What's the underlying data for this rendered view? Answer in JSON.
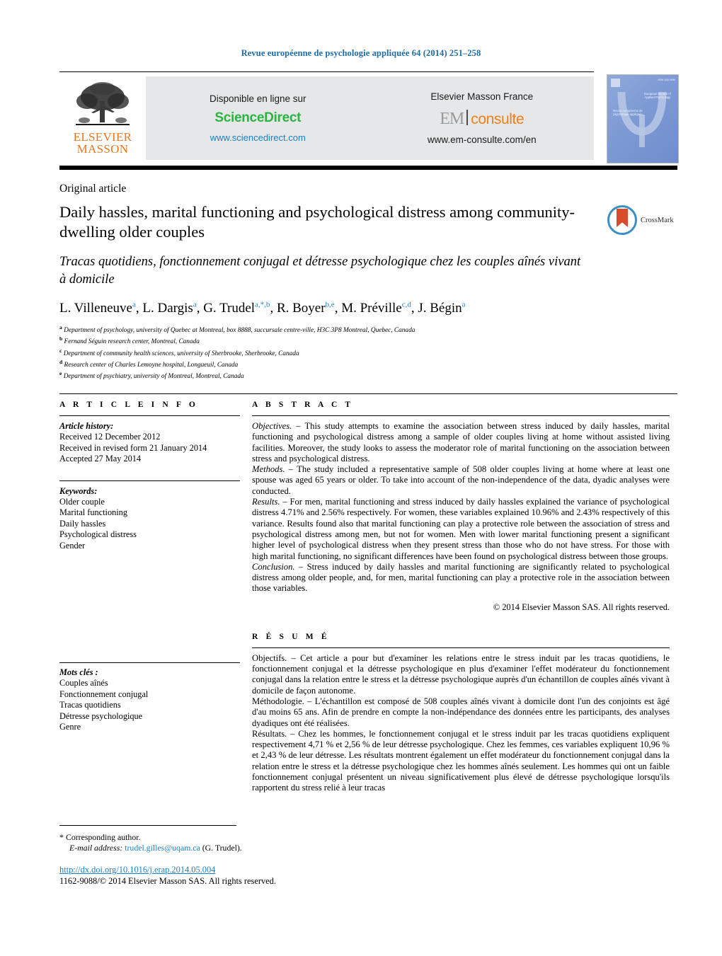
{
  "running_head": "Revue européenne de psychologie appliquée 64 (2014) 251–258",
  "masthead": {
    "publisher_logo_line1": "ELSEVIER",
    "publisher_logo_line2": "MASSON",
    "left_panel": {
      "available_label": "Disponible en ligne sur",
      "logo_text": "ScienceDirect",
      "url": "www.sciencedirect.com"
    },
    "right_panel": {
      "publisher_label": "Elsevier Masson France",
      "logo_em": "EM",
      "logo_consulte": "consulte",
      "url": "www.em-consulte.com/en"
    }
  },
  "cover": {
    "line_top": "ISSN 1162-9088",
    "title_right": "European Review of Applied Psychology",
    "title_left": "Revue européenne de psychologie appliquée"
  },
  "article": {
    "type": "Original article",
    "title": "Daily hassles, marital functioning and psychological distress among community-dwelling older couples",
    "subtitle": "Tracas quotidiens, fonctionnement conjugal et détresse psychologique chez les couples aînés vivant à domicile",
    "crossmark_label": "CrossMark",
    "authors": [
      {
        "name": "L. Villeneuve",
        "sup": "a"
      },
      {
        "name": "L. Dargis",
        "sup": "a"
      },
      {
        "name": "G. Trudel",
        "sup": "a,*,b"
      },
      {
        "name": "R. Boyer",
        "sup": "b,e"
      },
      {
        "name": "M. Préville",
        "sup": "c,d"
      },
      {
        "name": "J. Bégin",
        "sup": "a"
      }
    ],
    "affiliations": [
      {
        "label": "a",
        "text": "Department of psychology, university of Quebec at Montreal, box 8888, succursale centre-ville, H3C 3P8 Montreal, Quebec, Canada"
      },
      {
        "label": "b",
        "text": "Fernand Séguin research center, Montreal, Canada"
      },
      {
        "label": "c",
        "text": "Department of community health sciences, university of Sherbrooke, Sherbrooke, Canada"
      },
      {
        "label": "d",
        "text": "Research center of Charles Lemoyne hospital, Longueuil, Canada"
      },
      {
        "label": "e",
        "text": "Department of psychiatry, university of Montreal, Montreal, Canada"
      }
    ]
  },
  "article_info": {
    "heading": "A R T I C L E   I N F O",
    "history_label": "Article history:",
    "history": [
      "Received 12 December 2012",
      "Received in revised form 21 January 2014",
      "Accepted 27 May 2014"
    ],
    "keywords_label": "Keywords:",
    "keywords": [
      "Older couple",
      "Marital functioning",
      "Daily hassles",
      "Psychological distress",
      "Gender"
    ]
  },
  "mots_cles": {
    "label": "Mots clés :",
    "items": [
      "Couples aînés",
      "Fonctionnement conjugal",
      "Tracas quotidiens",
      "Détresse psychologique",
      "Genre"
    ]
  },
  "abstract": {
    "heading": "A B S T R A C T",
    "sections": [
      {
        "lead": "Objectives. – ",
        "text": "This study attempts to examine the association between stress induced by daily hassles, marital functioning and psychological distress among a sample of older couples living at home without assisted living facilities. Moreover, the study looks to assess the moderator role of marital functioning on the association between stress and psychological distress."
      },
      {
        "lead": "Methods. – ",
        "text": "The study included a representative sample of 508 older couples living at home where at least one spouse was aged 65 years or older. To take into account of the non-independence of the data, dyadic analyses were conducted."
      },
      {
        "lead": "Results. – ",
        "text": "For men, marital functioning and stress induced by daily hassles explained the variance of psychological distress 4.71% and 2.56% respectively. For women, these variables explained 10.96% and 2.43% respectively of this variance. Results found also that marital functioning can play a protective role between the association of stress and psychological distress among men, but not for women. Men with lower marital functioning present a significant higher level of psychological distress when they present stress than those who do not have stress. For those with high marital functioning, no significant differences have been found on psychological distress between those groups."
      },
      {
        "lead": "Conclusion. – ",
        "text": "Stress induced by daily hassles and marital functioning are significantly related to psychological distress among older people, and, for men, marital functioning can play a protective role in the association between those variables."
      }
    ],
    "copyright": "© 2014 Elsevier Masson SAS. All rights reserved."
  },
  "resume": {
    "heading": "R É S U M É",
    "sections": [
      {
        "lead": "Objectifs. – ",
        "text": "Cet article a pour but d'examiner les relations entre le stress induit par les tracas quotidiens, le fonctionnement conjugal et la détresse psychologique en plus d'examiner l'effet modérateur du fonctionnement conjugal dans la relation entre le stress et la détresse psychologique auprès d'un échantillon de couples aînés vivant à domicile de façon autonome."
      },
      {
        "lead": "Méthodologie. – ",
        "text": "L'échantillon est composé de 508 couples aînés vivant à domicile dont l'un des conjoints est âgé d'au moins 65 ans. Afin de prendre en compte la non-indépendance des données entre les participants, des analyses dyadiques ont été réalisées."
      },
      {
        "lead": "Résultats. – ",
        "text": "Chez les hommes, le fonctionnement conjugal et le stress induit par les tracas quotidiens expliquent respectivement 4,71 % et 2,56 % de leur détresse psychologique. Chez les femmes, ces variables expliquent 10,96 % et 2,43 % de leur détresse. Les résultats montrent également un effet modérateur du fonctionnement conjugal dans la relation entre le stress et la détresse psychologique chez les hommes aînés seulement. Les hommes qui ont un faible fonctionnement conjugal présentent un niveau significativement plus élevé de détresse psychologique lorsqu'ils rapportent du stress relié à leur tracas"
      }
    ]
  },
  "footer": {
    "corresponding_star": "*",
    "corresponding_label": "Corresponding author.",
    "email_label": "E-mail address:",
    "email": "trudel.gilles@uqam.ca",
    "email_owner": "(G. Trudel).",
    "doi": "http://dx.doi.org/10.1016/j.erap.2014.05.004",
    "issn_line": "1162-9088/© 2014 Elsevier Masson SAS. All rights reserved."
  }
}
